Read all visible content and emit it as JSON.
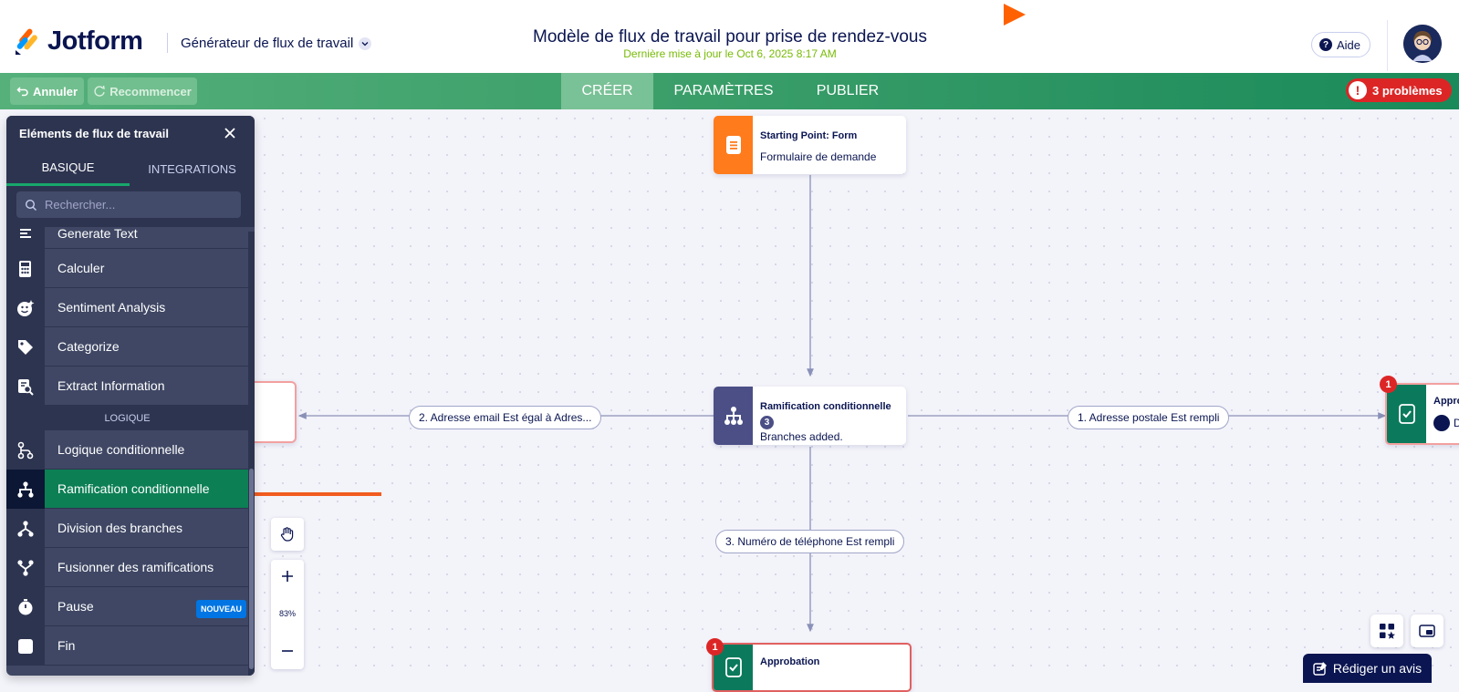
{
  "header": {
    "brand": "Jotform",
    "app_title": "Générateur de flux de travail",
    "doc_title": "Modèle de flux de travail pour prise de rendez-vous",
    "last_updated": "Dernière mise à jour le Oct 6, 2025 8:17 AM",
    "help_label": "Aide"
  },
  "toolbar": {
    "undo_label": "Annuler",
    "redo_label": "Recommencer",
    "tabs": [
      "CRÉER",
      "PARAMÈTRES",
      "PUBLIER"
    ],
    "active_tab": "CRÉER",
    "problems_label": "3 problèmes"
  },
  "panel": {
    "title": "Eléments de flux de travail",
    "tabs": [
      "BASIQUE",
      "INTEGRATIONS"
    ],
    "search_placeholder": "Rechercher...",
    "items": [
      {
        "label": "Generate Text",
        "icon": "generate-text-icon"
      },
      {
        "label": "Calculer",
        "icon": "calculator-icon"
      },
      {
        "label": "Sentiment Analysis",
        "icon": "sentiment-icon"
      },
      {
        "label": "Categorize",
        "icon": "categorize-icon"
      },
      {
        "label": "Extract Information",
        "icon": "extract-icon"
      }
    ],
    "group_label": "LOGIQUE",
    "logic_items": [
      {
        "label": "Logique conditionnelle",
        "icon": "conditional-logic-icon"
      },
      {
        "label": "Ramification conditionnelle",
        "icon": "conditional-branch-icon",
        "selected": true
      },
      {
        "label": "Division des branches",
        "icon": "split-branches-icon"
      },
      {
        "label": "Fusionner des ramifications",
        "icon": "merge-branches-icon"
      },
      {
        "label": "Pause",
        "icon": "stopwatch-icon",
        "badge": "NOUVEAU"
      },
      {
        "label": "Fin",
        "icon": "end-icon"
      }
    ]
  },
  "canvas": {
    "start_node": {
      "title": "Starting Point: Form",
      "subtitle": "Formulaire de demande"
    },
    "branch_node": {
      "title": "Ramification conditionnelle",
      "count": "3",
      "subtitle": "Branches added."
    },
    "edges": [
      "2. Adresse email Est égal à Adres...",
      "1. Adresse postale Est rempli",
      "3. Numéro de téléphone Est rempli"
    ],
    "approval_bottom": {
      "title": "Approbation",
      "badge": "1"
    },
    "approval_right": {
      "title": "Appro",
      "badge": "1",
      "avatar_text": "D"
    },
    "zoom": "83%"
  },
  "review_label": "Rédiger un avis",
  "colors": {
    "brand_navy": "#0a1551",
    "accent_green": "#0c7f55",
    "form_orange": "#ff7b1c",
    "branch_purple": "#4b4f86",
    "approval_green": "#0b7a5c",
    "error_red": "#dc2626"
  }
}
